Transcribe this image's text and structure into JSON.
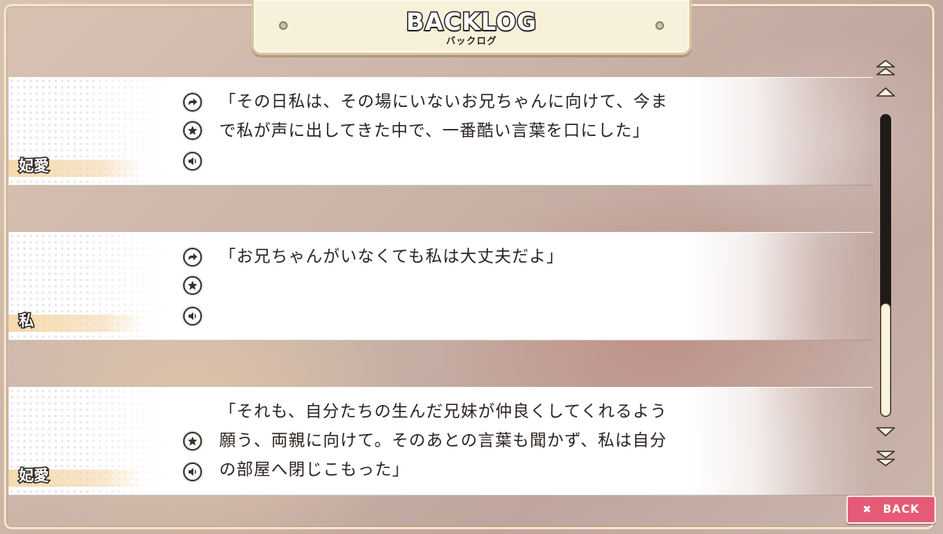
{
  "header": {
    "title": "BACKLOG",
    "subtitle": "バックログ"
  },
  "entries": [
    {
      "speaker": "妃愛",
      "text": "「その日私は、その場にいないお兄ちゃんに向けて、今ま\nで私が声に出してきた中で、一番酷い言葉を口にした」",
      "icons": [
        "jump-icon",
        "star-icon",
        "voice-icon"
      ]
    },
    {
      "speaker": "私",
      "text": "「お兄ちゃんがいなくても私は大丈夫だよ」",
      "icons": [
        "jump-icon",
        "star-icon",
        "voice-icon"
      ]
    },
    {
      "speaker": "妃愛",
      "text": "「それも、自分たちの生んだ兄妹が仲良くしてくれるよう\n願う、両親に向けて。そのあとの言葉も聞かず、私は自分\nの部屋へ閉じこもった」",
      "icons": [
        "star-icon",
        "voice-icon"
      ]
    }
  ],
  "scroll": {
    "position": 0.78
  },
  "back_button": {
    "label": "BACK",
    "icon": "close-icon"
  },
  "colors": {
    "accent": "#e55a74",
    "panel": "#f7f1dc",
    "outline": "#2b2522"
  }
}
